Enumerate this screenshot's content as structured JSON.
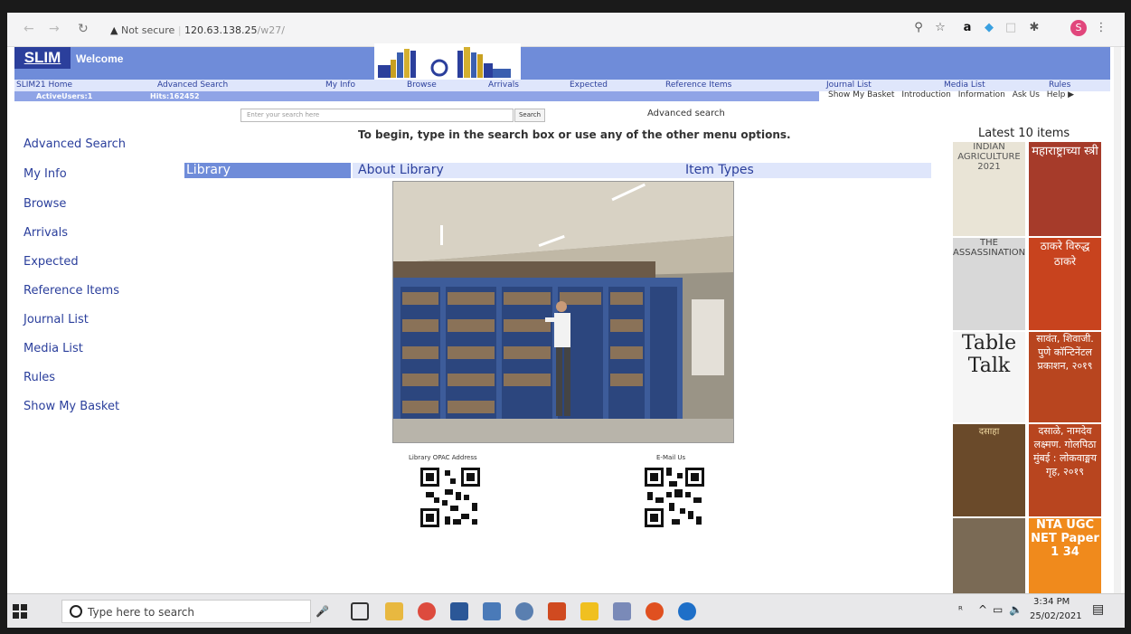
{
  "browser": {
    "security_label": "Not secure",
    "host": "120.63.138.25",
    "path": "/w27/"
  },
  "header": {
    "logo_text": "SLIM",
    "welcome_text": "Welcome"
  },
  "top_menu": [
    "SLIM21 Home",
    "Advanced Search",
    "My Info",
    "Browse",
    "Arrivals",
    "Expected",
    "Reference Items",
    "Journal List",
    "Media List",
    "Rules"
  ],
  "status": {
    "active_users": "ActiveUsers:1",
    "hits": "Hits:162452"
  },
  "right_links": [
    "Show My Basket",
    "Introduction",
    "Information",
    "Ask Us",
    "Help ▶"
  ],
  "search": {
    "placeholder": "Enter your search here",
    "button_label": "Search",
    "advanced_label": "Advanced search"
  },
  "instruction": "To begin, type in the search box or use any of the other menu options.",
  "left_menu": [
    "Advanced Search",
    "My Info",
    "Browse",
    "Arrivals",
    "Expected",
    "Reference Items",
    "Journal List",
    "Media List",
    "Rules",
    "Show My Basket"
  ],
  "tabs": {
    "library": "Library",
    "about": "About Library",
    "item_types": "Item Types"
  },
  "qr": {
    "opac_label": "Library OPAC Address",
    "email_label": "E-Mail Us"
  },
  "latest": {
    "title": "Latest 10 items",
    "covers": [
      {
        "text": "INDIAN AGRICULTURE 2021",
        "bg": "#e9e4d6",
        "fg": "#555555"
      },
      {
        "text": "महाराष्ट्राच्या स्त्री",
        "bg": "#a63b2a",
        "fg": "#ffffff"
      },
      {
        "text": "THE ASSASSINATION",
        "bg": "#d8d8d8",
        "fg": "#444444"
      },
      {
        "text": "ठाकरे विरुद्ध ठाकरे",
        "bg": "#c8431e",
        "fg": "#ffffff"
      },
      {
        "text": "Table Talk",
        "bg": "#f5f5f5",
        "fg": "#222222"
      },
      {
        "text": "सावंत, शिवाजी. पुणे कॉन्टिनेंटल प्रकाशन, २०१९",
        "bg": "#b8451f",
        "fg": "#ffffff"
      },
      {
        "text": "दसाहा",
        "bg": "#6a4a2a",
        "fg": "#f0d8a0"
      },
      {
        "text": "दसाळे, नामदेव लक्ष्मण. गोलपिठा मुंबई : लोकवाङ्मय गृह, २०१९",
        "bg": "#b8451f",
        "fg": "#ffffff"
      },
      {
        "text": "",
        "bg": "#7a6a55",
        "fg": "#ffffff"
      },
      {
        "text": "NTA UGC NET Paper 1 34",
        "bg": "#f08a1c",
        "fg": "#ffffff"
      }
    ]
  },
  "taskbar": {
    "search_placeholder": "Type here to search",
    "time": "3:34 PM",
    "date": "25/02/2021"
  },
  "colors": {
    "brand_blue": "#6f8cd9",
    "dark_blue": "#2b3f9c",
    "light_blue": "#dfe6fb"
  }
}
